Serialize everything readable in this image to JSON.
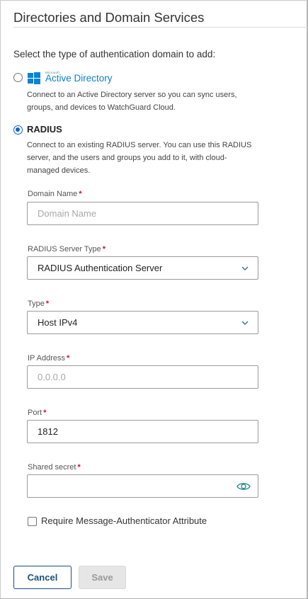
{
  "header": {
    "title": "Directories and Domain Services"
  },
  "prompt": "Select the type of authentication domain to add:",
  "options": {
    "active_directory": {
      "logo_small": "Microsoft",
      "logo_text": "Active Directory",
      "description_line1": "Connect to an Active Directory server so you can sync users,",
      "description_line2": "groups, and devices to WatchGuard Cloud.",
      "selected": false
    },
    "radius": {
      "label": "RADIUS",
      "description_line1": "Connect to an existing RADIUS server. You can use this RADIUS",
      "description_line2": "server, and the users and groups you add to it, with cloud-",
      "description_line3": "managed devices.",
      "selected": true
    }
  },
  "form": {
    "domain_name": {
      "label": "Domain Name",
      "required": "*",
      "value": "",
      "placeholder": "Domain Name"
    },
    "radius_server_type": {
      "label": "RADIUS Server Type",
      "required": "*",
      "value": "RADIUS Authentication Server"
    },
    "type": {
      "label": "Type",
      "required": "*",
      "value": "Host IPv4"
    },
    "ip_address": {
      "label": "IP Address",
      "required": "*",
      "value": "",
      "placeholder": "0.0.0.0"
    },
    "port": {
      "label": "Port",
      "required": "*",
      "value": "1812"
    },
    "shared_secret": {
      "label": "Shared secret",
      "required": "*",
      "value": ""
    },
    "message_authenticator": {
      "label": "Require Message-Authenticator Attribute",
      "checked": false
    }
  },
  "actions": {
    "cancel_label": "Cancel",
    "save_label": "Save"
  },
  "colors": {
    "accent": "#0a63c9",
    "ad_blue": "#0a7fd0",
    "required": "#c8102e",
    "cancel_border": "#1d4f7c",
    "eye_icon": "#2e8f8f"
  },
  "icons": {
    "ad_logo": "windows-logo-icon",
    "dropdown": "chevron-down-icon",
    "reveal": "eye-icon"
  }
}
